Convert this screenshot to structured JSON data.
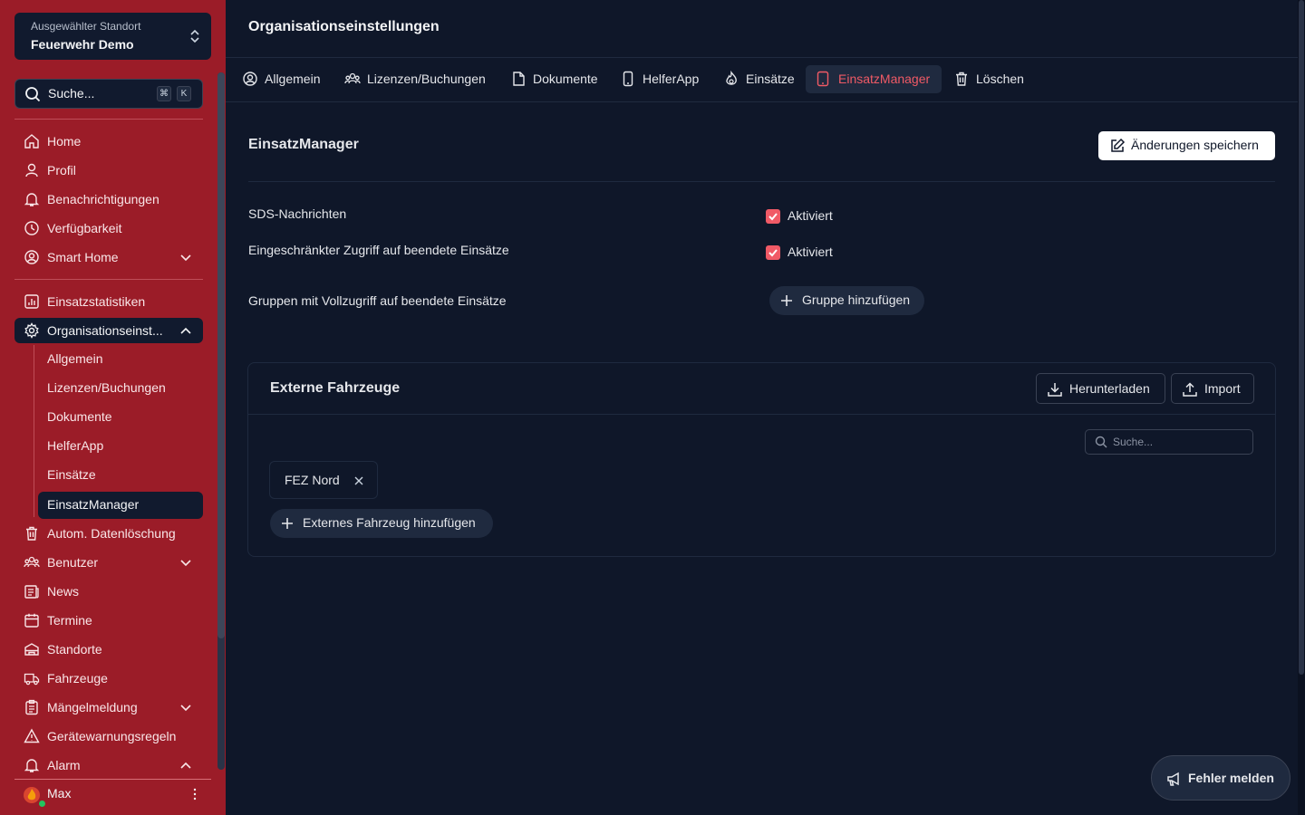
{
  "location": {
    "label": "Ausgewählter Standort",
    "value": "Feuerwehr Demo"
  },
  "search": {
    "label": "Suche...",
    "kbd_mod": "⌘",
    "kbd_key": "K"
  },
  "sidebar": {
    "items": [
      {
        "label": "Home",
        "icon": "home-icon"
      },
      {
        "label": "Profil",
        "icon": "user-icon"
      },
      {
        "label": "Benachrichtigungen",
        "icon": "bell-icon"
      },
      {
        "label": "Verfügbarkeit",
        "icon": "clock-icon"
      },
      {
        "label": "Smart Home",
        "icon": "user-circle-icon"
      },
      {
        "label": "Einsatzstatistiken",
        "icon": "chart-icon"
      },
      {
        "label": "Organisationseinst...",
        "icon": "gear-icon"
      },
      {
        "label": "Autom. Datenlöschung",
        "icon": "trash-icon"
      },
      {
        "label": "Benutzer",
        "icon": "users-icon"
      },
      {
        "label": "News",
        "icon": "news-icon"
      },
      {
        "label": "Termine",
        "icon": "calendar-icon"
      },
      {
        "label": "Standorte",
        "icon": "building-icon"
      },
      {
        "label": "Fahrzeuge",
        "icon": "truck-icon"
      },
      {
        "label": "Mängelmeldung",
        "icon": "clipboard-icon"
      },
      {
        "label": "Gerätewarnungsregeln",
        "icon": "warning-icon"
      },
      {
        "label": "Alarm",
        "icon": "bell-icon"
      }
    ],
    "subitems": [
      "Allgemein",
      "Lizenzen/Buchungen",
      "Dokumente",
      "HelferApp",
      "Einsätze",
      "EinsatzManager"
    ],
    "user": "Max"
  },
  "main": {
    "title": "Organisationseinstellungen",
    "tabs": [
      {
        "label": "Allgemein",
        "icon": "user-circle-icon"
      },
      {
        "label": "Lizenzen/Buchungen",
        "icon": "users-icon"
      },
      {
        "label": "Dokumente",
        "icon": "document-icon"
      },
      {
        "label": "HelferApp",
        "icon": "phone-icon"
      },
      {
        "label": "Einsätze",
        "icon": "fire-icon"
      },
      {
        "label": "EinsatzManager",
        "icon": "tablet-icon"
      },
      {
        "label": "Löschen",
        "icon": "trash-icon"
      }
    ],
    "section_title": "EinsatzManager",
    "save_label": "Änderungen speichern",
    "settings": [
      {
        "label": "SDS-Nachrichten",
        "value": "Aktiviert",
        "checked": true
      },
      {
        "label": "Eingeschränkter Zugriff auf beendete Einsätze",
        "value": "Aktiviert",
        "checked": true
      }
    ],
    "groups": {
      "label": "Gruppen mit Vollzugriff auf beendete Einsätze",
      "button": "Gruppe hinzufügen"
    },
    "vehicles": {
      "title": "Externe Fahrzeuge",
      "download_label": "Herunterladen",
      "import_label": "Import",
      "search_placeholder": "Suche...",
      "items": [
        "FEZ Nord"
      ],
      "add_label": "Externes Fahrzeug hinzufügen"
    },
    "report_label": "Fehler melden"
  },
  "colors": {
    "sidebar": "#9b1c28",
    "background": "#0f1729",
    "accent": "#f05a66",
    "online": "#22c55e"
  }
}
